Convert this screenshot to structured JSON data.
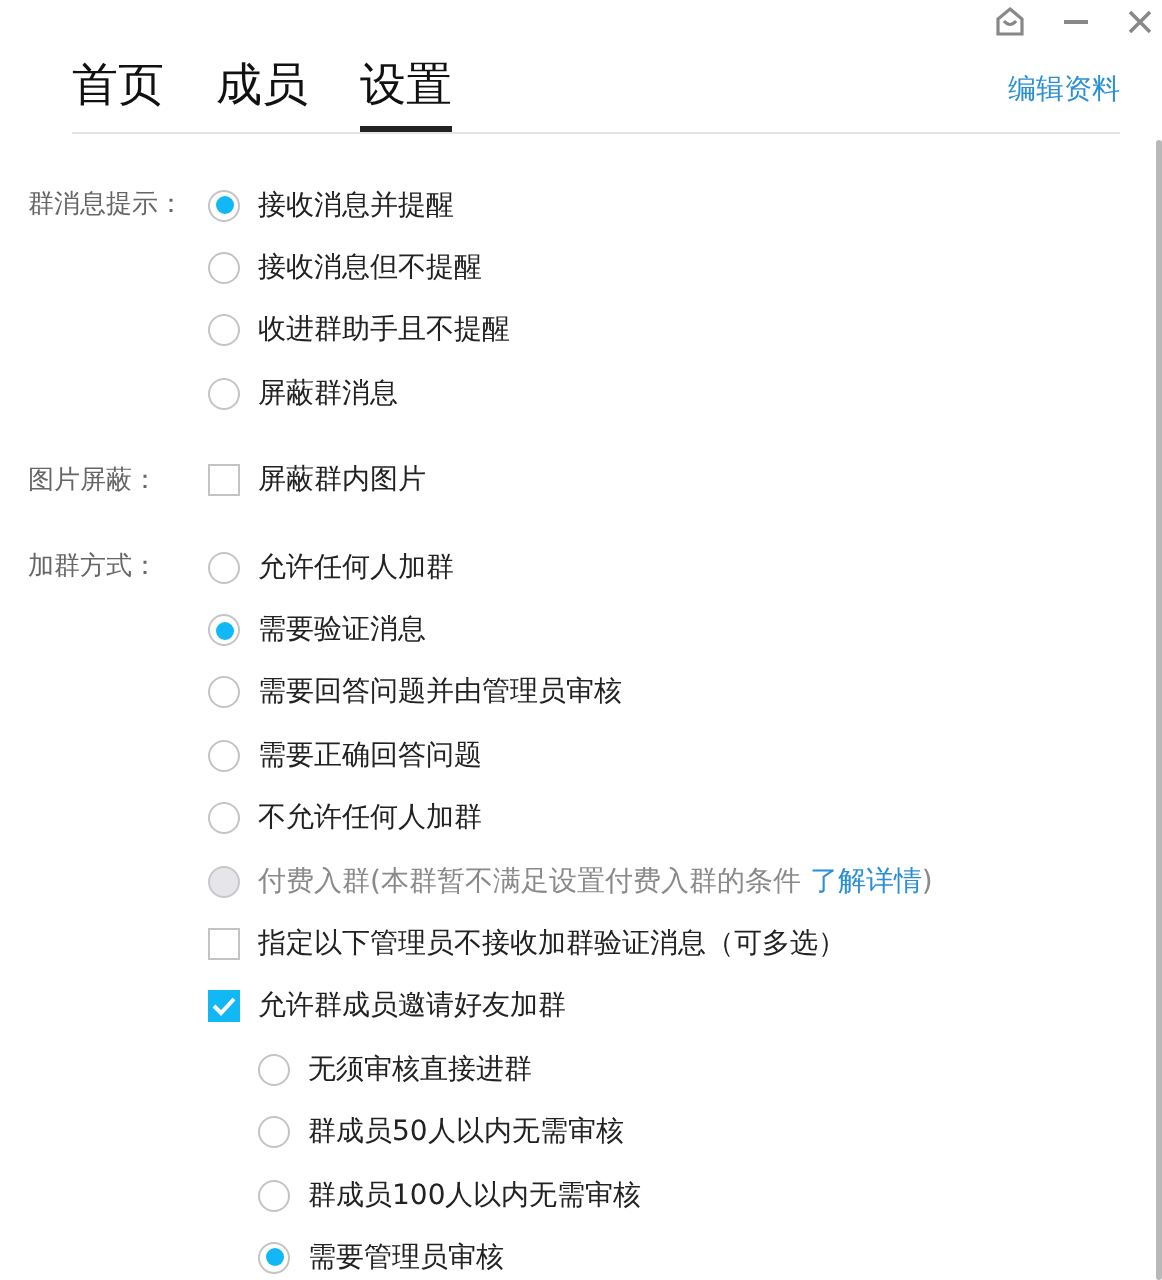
{
  "tabs": [
    {
      "label": "首页",
      "selected": false
    },
    {
      "label": "成员",
      "selected": false
    },
    {
      "label": "设置",
      "selected": true
    }
  ],
  "edit_link": "编辑资料",
  "sections": [
    {
      "label": "群消息提示：",
      "options": [
        {
          "kind": "radio",
          "text": "接收消息并提醒",
          "selected": true
        },
        {
          "kind": "radio",
          "text": "接收消息但不提醒",
          "selected": false
        },
        {
          "kind": "radio",
          "text": "收进群助手且不提醒",
          "selected": false
        },
        {
          "kind": "radio",
          "text": "屏蔽群消息",
          "selected": false
        }
      ]
    },
    {
      "label": "图片屏蔽：",
      "options": [
        {
          "kind": "checkbox",
          "text": "屏蔽群内图片",
          "checked": false
        }
      ]
    },
    {
      "label": "加群方式：",
      "options": [
        {
          "kind": "radio",
          "text": "允许任何人加群",
          "selected": false
        },
        {
          "kind": "radio",
          "text": "需要验证消息",
          "selected": true
        },
        {
          "kind": "radio",
          "text": "需要回答问题并由管理员审核",
          "selected": false
        },
        {
          "kind": "radio",
          "text": "需要正确回答问题",
          "selected": false
        },
        {
          "kind": "radio",
          "text": "不允许任何人加群",
          "selected": false
        },
        {
          "kind": "radio",
          "text": "付费入群(本群暂不满足设置付费入群的条件 ",
          "link": "了解详情",
          "suffix": ")",
          "selected": false,
          "disabled": true
        },
        {
          "kind": "checkbox",
          "text": "指定以下管理员不接收加群验证消息（可多选）",
          "checked": false
        },
        {
          "kind": "checkbox",
          "text": "允许群成员邀请好友加群",
          "checked": true,
          "children": [
            {
              "kind": "radio",
              "text": "无须审核直接进群",
              "selected": false
            },
            {
              "kind": "radio",
              "text": "群成员50人以内无需审核",
              "selected": false
            },
            {
              "kind": "radio",
              "text": "群成员100人以内无需审核",
              "selected": false
            },
            {
              "kind": "radio",
              "text": "需要管理员审核",
              "selected": true
            }
          ]
        }
      ]
    }
  ]
}
